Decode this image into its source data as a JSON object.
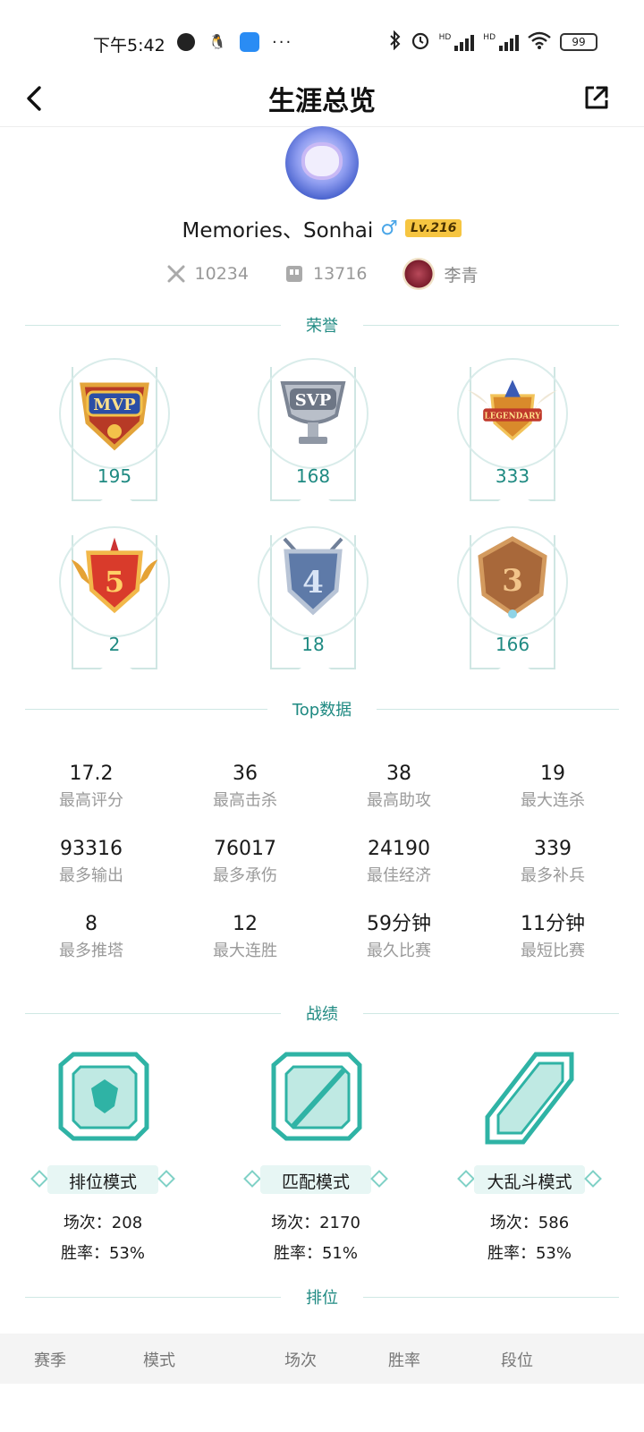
{
  "status_bar": {
    "time": "下午5:42",
    "more": "···",
    "battery": "99",
    "hd1": "HD",
    "hd2": "HD"
  },
  "header": {
    "title": "生涯总览"
  },
  "profile": {
    "name": "Memories、Sonhai",
    "gender_symbol": "♂",
    "level": "Lv.216",
    "stat_a": "10234",
    "stat_b": "13716",
    "hero_name": "李青"
  },
  "sections": {
    "honors": "荣誉",
    "top_data": "Top数据",
    "records": "战绩",
    "rank": "排位"
  },
  "honors": [
    {
      "badge": "MVP",
      "count": "195"
    },
    {
      "badge": "SVP",
      "count": "168"
    },
    {
      "badge": "LEGENDARY",
      "count": "333"
    },
    {
      "badge": "5",
      "count": "2"
    },
    {
      "badge": "4",
      "count": "18"
    },
    {
      "badge": "3",
      "count": "166"
    }
  ],
  "top_data": [
    {
      "value": "17.2",
      "label": "最高评分"
    },
    {
      "value": "36",
      "label": "最高击杀"
    },
    {
      "value": "38",
      "label": "最高助攻"
    },
    {
      "value": "19",
      "label": "最大连杀"
    },
    {
      "value": "93316",
      "label": "最多输出"
    },
    {
      "value": "76017",
      "label": "最多承伤"
    },
    {
      "value": "24190",
      "label": "最佳经济"
    },
    {
      "value": "339",
      "label": "最多补兵"
    },
    {
      "value": "8",
      "label": "最多推塔"
    },
    {
      "value": "12",
      "label": "最大连胜"
    },
    {
      "value": "59分钟",
      "label": "最久比赛"
    },
    {
      "value": "11分钟",
      "label": "最短比赛"
    }
  ],
  "records": [
    {
      "mode": "排位模式",
      "games": "场次：208",
      "winrate": "胜率：53%"
    },
    {
      "mode": "匹配模式",
      "games": "场次：2170",
      "winrate": "胜率：51%"
    },
    {
      "mode": "大乱斗模式",
      "games": "场次：586",
      "winrate": "胜率：53%"
    }
  ],
  "rank_table": {
    "columns": [
      "赛季",
      "模式",
      "场次",
      "胜率",
      "段位"
    ]
  },
  "colors": {
    "accent": "#1f8a82",
    "level_badge": "#f6c541",
    "gender": "#4aa6e8"
  }
}
